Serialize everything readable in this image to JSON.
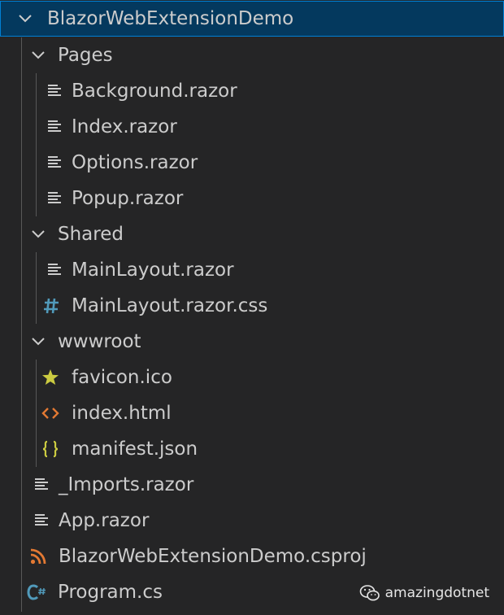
{
  "explorer": {
    "root": {
      "label": "BlazorWebExtensionDemo"
    },
    "pages": {
      "label": "Pages",
      "files": [
        "Background.razor",
        "Index.razor",
        "Options.razor",
        "Popup.razor"
      ]
    },
    "shared": {
      "label": "Shared",
      "files": [
        "MainLayout.razor",
        "MainLayout.razor.css"
      ]
    },
    "wwwroot": {
      "label": "wwwroot",
      "files": [
        "favicon.ico",
        "index.html",
        "manifest.json"
      ]
    },
    "root_files": [
      "_Imports.razor",
      "App.razor",
      "BlazorWebExtensionDemo.csproj",
      "Program.cs"
    ]
  },
  "icons": {
    "lines": "lines-file-icon",
    "hash": "hash-css-icon",
    "star": "star-icon",
    "code": "code-brackets-icon",
    "braces": "curly-braces-icon",
    "rss": "rss-icon",
    "csharp": "csharp-icon"
  },
  "colors": {
    "background": "#252526",
    "selection": "#04395e",
    "text": "#cccccc",
    "css_icon": "#519aba",
    "star_icon": "#cbcb41",
    "html_icon": "#e37933",
    "json_icon": "#cbcb41",
    "csproj_icon": "#e37933",
    "csharp_icon": "#519aba"
  },
  "watermark": {
    "label": "amazingdotnet"
  }
}
